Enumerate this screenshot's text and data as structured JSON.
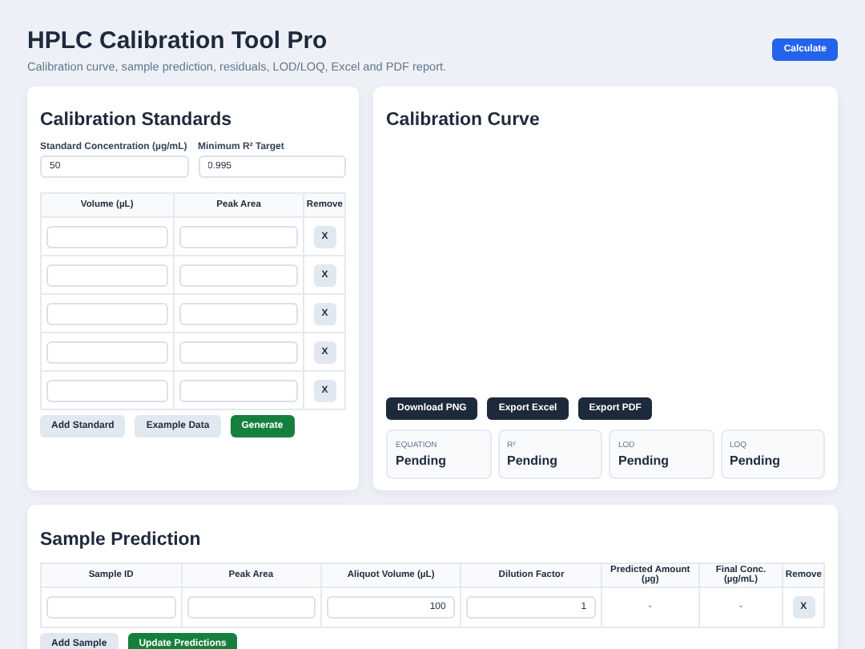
{
  "header": {
    "title": "HPLC Calibration Tool Pro",
    "subtitle": "Calibration curve, sample prediction, residuals, LOD/LOQ, Excel and PDF report.",
    "action": "Calculate"
  },
  "standards": {
    "title": "Calibration Standards",
    "fields": [
      {
        "label": "Standard Concentration (µg/mL)",
        "value": "50"
      },
      {
        "label": "Minimum R² Target",
        "value": "0.995"
      }
    ],
    "columns": [
      "Volume (µL)",
      "Peak Area",
      "Remove"
    ],
    "rows": [
      {
        "remove": "X"
      },
      {
        "remove": "X"
      },
      {
        "remove": "X"
      },
      {
        "remove": "X"
      },
      {
        "remove": "X"
      }
    ],
    "buttons": [
      {
        "label": "Add Standard",
        "kind": "secondary"
      },
      {
        "label": "Example Data",
        "kind": "secondary"
      },
      {
        "label": "Generate",
        "kind": "primary"
      }
    ]
  },
  "curve": {
    "title": "Calibration Curve",
    "buttons": [
      {
        "label": "Download PNG",
        "kind": "dark"
      },
      {
        "label": "Export Excel",
        "kind": "dark"
      },
      {
        "label": "Export PDF",
        "kind": "dark"
      }
    ],
    "stats": [
      {
        "label": "EQUATION",
        "value": "Pending"
      },
      {
        "label": "R²",
        "value": "Pending"
      },
      {
        "label": "LOD",
        "value": "Pending"
      },
      {
        "label": "LOQ",
        "value": "Pending"
      }
    ]
  },
  "samples": {
    "title": "Sample Prediction",
    "columns": [
      "Sample ID",
      "Peak Area",
      "Aliquot Volume (µL)",
      "Dilution Factor",
      "Predicted Amount (µg)",
      "Final Conc. (µg/mL)",
      "Remove"
    ],
    "rows": [
      {
        "aliquot_volume": "100",
        "dilution_factor": "1",
        "predicted_amount": "-",
        "final_conc": "-",
        "remove": "X"
      }
    ],
    "buttons": [
      {
        "label": "Add Sample",
        "kind": "secondary"
      },
      {
        "label": "Update Predictions",
        "kind": "primary"
      }
    ]
  }
}
